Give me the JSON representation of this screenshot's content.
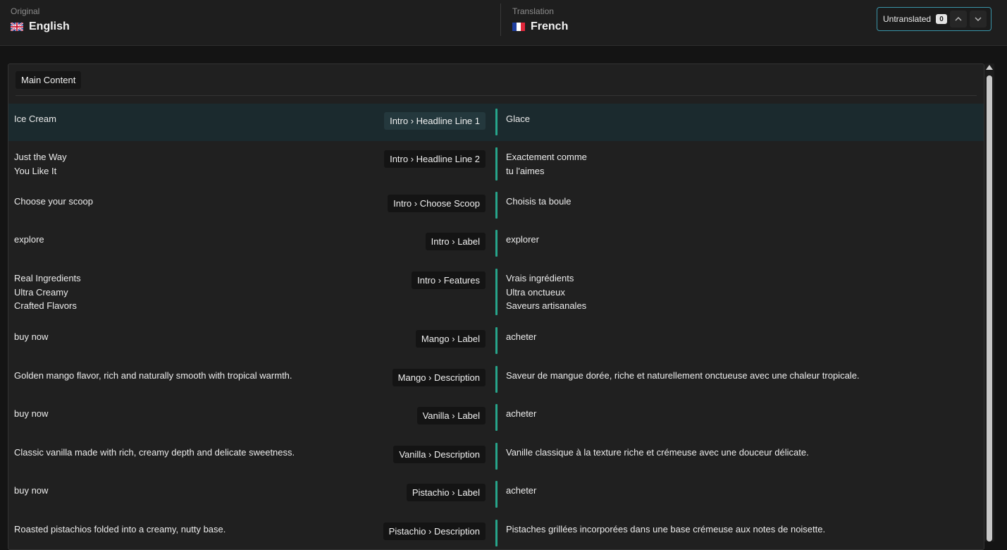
{
  "header": {
    "original": {
      "caption": "Original",
      "language": "English",
      "flag_icon": "uk-flag-icon"
    },
    "translation": {
      "caption": "Translation",
      "language": "French",
      "flag_icon": "france-flag-icon"
    },
    "untranslated": {
      "label": "Untranslated",
      "count": "0"
    }
  },
  "colors": {
    "accent": "#27a58b",
    "focus_border": "#3a95a8",
    "active_row": "#1b2a2e"
  },
  "section": {
    "title": "Main Content"
  },
  "rows": [
    {
      "source": "Ice Cream",
      "key": "Intro › Headline Line 1",
      "target": "Glace",
      "active": true
    },
    {
      "source": "Just the Way\nYou Like It",
      "key": "Intro › Headline Line 2",
      "target": "Exactement comme\ntu l'aimes"
    },
    {
      "source": "Choose your scoop",
      "key": "Intro › Choose Scoop",
      "target": "Choisis ta boule"
    },
    {
      "source": "explore",
      "key": "Intro › Label",
      "target": "explorer"
    },
    {
      "source": "Real Ingredients\nUltra Creamy\nCrafted Flavors",
      "key": "Intro › Features",
      "target": "Vrais ingrédients\nUltra onctueux\nSaveurs artisanales"
    },
    {
      "source": "buy now",
      "key": "Mango › Label",
      "target": "acheter"
    },
    {
      "source": "Golden mango flavor, rich and naturally smooth with tropical warmth.",
      "key": "Mango › Description",
      "target": "Saveur de mangue dorée, riche et naturellement onctueuse avec une chaleur tropicale."
    },
    {
      "source": "buy now",
      "key": "Vanilla › Label",
      "target": "acheter"
    },
    {
      "source": "Classic vanilla made with rich, creamy depth and delicate sweetness.",
      "key": "Vanilla › Description",
      "target": "Vanille classique à la texture riche et crémeuse avec une douceur délicate."
    },
    {
      "source": "buy now",
      "key": "Pistachio › Label",
      "target": "acheter"
    },
    {
      "source": "Roasted pistachios folded into a creamy, nutty base.",
      "key": "Pistachio › Description",
      "target": "Pistaches grillées incorporées dans une base crémeuse aux notes de noisette."
    }
  ]
}
